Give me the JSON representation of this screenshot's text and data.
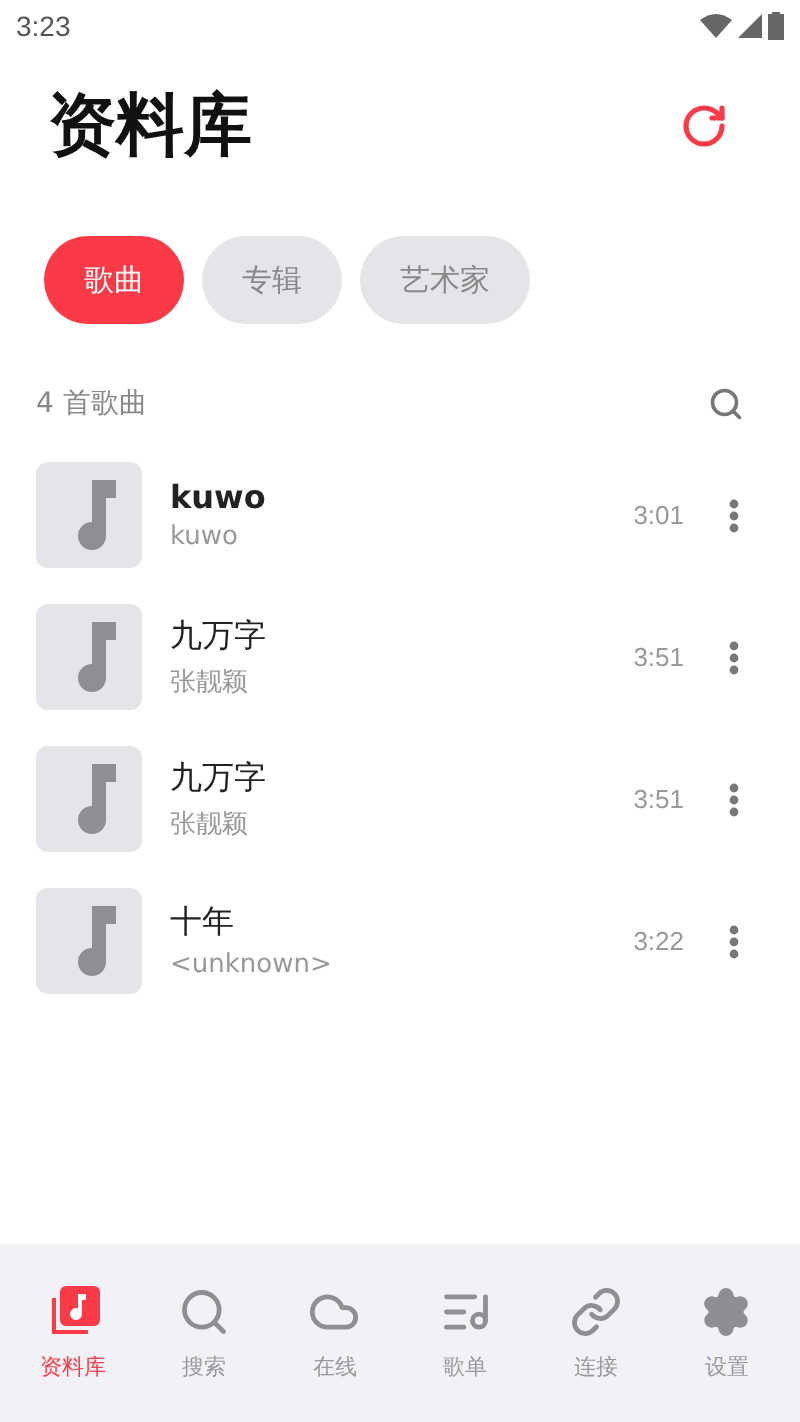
{
  "status_bar": {
    "time": "3:23"
  },
  "header": {
    "title": "资料库"
  },
  "tabs": [
    {
      "label": "歌曲",
      "selected": true
    },
    {
      "label": "专辑",
      "selected": false
    },
    {
      "label": "艺术家",
      "selected": false
    }
  ],
  "list_header": {
    "count": "4 首歌曲"
  },
  "songs": [
    {
      "title": "kuwo",
      "artist": "kuwo",
      "duration": "3:01",
      "playing": true
    },
    {
      "title": "九万字",
      "artist": "张靓颖",
      "duration": "3:51",
      "playing": false
    },
    {
      "title": "九万字",
      "artist": "张靓颖",
      "duration": "3:51",
      "playing": false
    },
    {
      "title": "十年",
      "artist": "<unknown>",
      "duration": "3:22",
      "playing": false
    }
  ],
  "nav": [
    {
      "kind": "library",
      "label": "资料库",
      "selected": true
    },
    {
      "kind": "search",
      "label": "搜索",
      "selected": false
    },
    {
      "kind": "cloud",
      "label": "在线",
      "selected": false
    },
    {
      "kind": "playlist",
      "label": "歌单",
      "selected": false
    },
    {
      "kind": "link",
      "label": "连接",
      "selected": false
    },
    {
      "kind": "settings",
      "label": "设置",
      "selected": false
    }
  ]
}
